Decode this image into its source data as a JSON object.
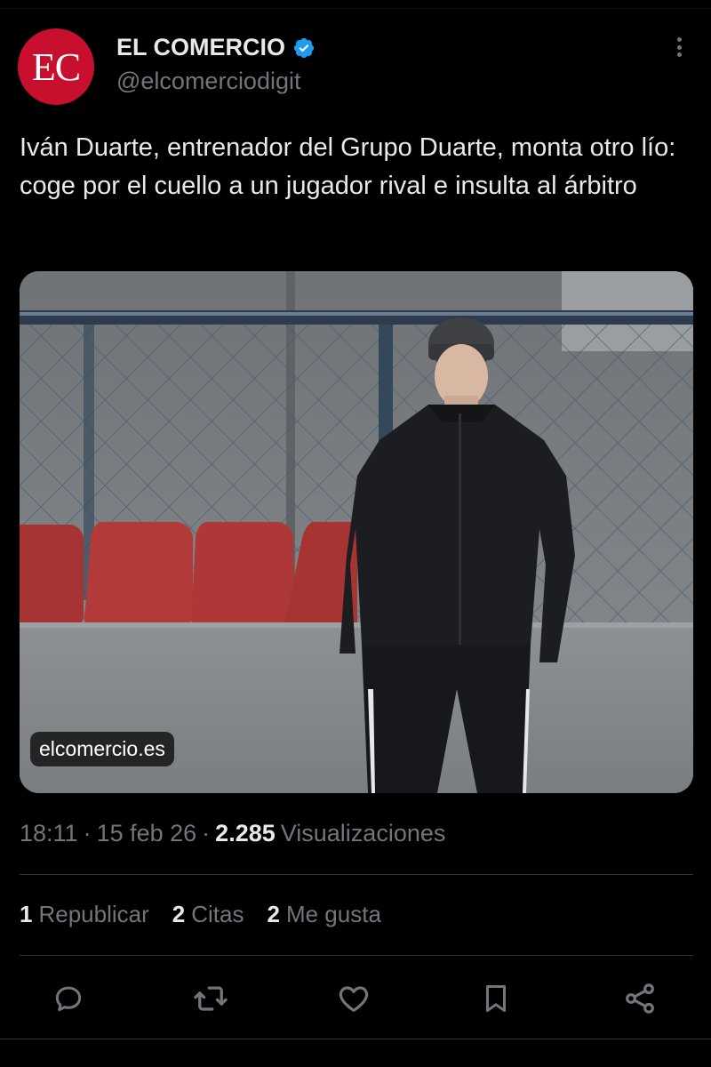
{
  "account": {
    "avatar_text": "EC",
    "display_name": "EL COMERCIO",
    "handle": "@elcomerciodigit",
    "verified": true
  },
  "tweet": {
    "text": "Iván Duarte, entrenador del Grupo Duarte, monta otro lío: coge por el cuello a un jugador rival e insulta al árbitro",
    "media_source": "elcomercio.es",
    "time": "18:11",
    "date": "15 feb 26",
    "views_count": "2.285",
    "views_label": "Visualizaciones",
    "separator": "·"
  },
  "stats": {
    "reposts_count": "1",
    "reposts_label": "Republicar",
    "quotes_count": "2",
    "quotes_label": "Citas",
    "likes_count": "2",
    "likes_label": "Me gusta"
  },
  "actions": [
    "reply-icon",
    "repost-icon",
    "like-icon",
    "bookmark-icon",
    "share-icon"
  ],
  "colors": {
    "background": "#000000",
    "text_primary": "#e7e9ea",
    "text_secondary": "#71767b",
    "divider": "#2f3336",
    "avatar_bg": "#c8102e",
    "verified_blue": "#1d9bf0"
  }
}
